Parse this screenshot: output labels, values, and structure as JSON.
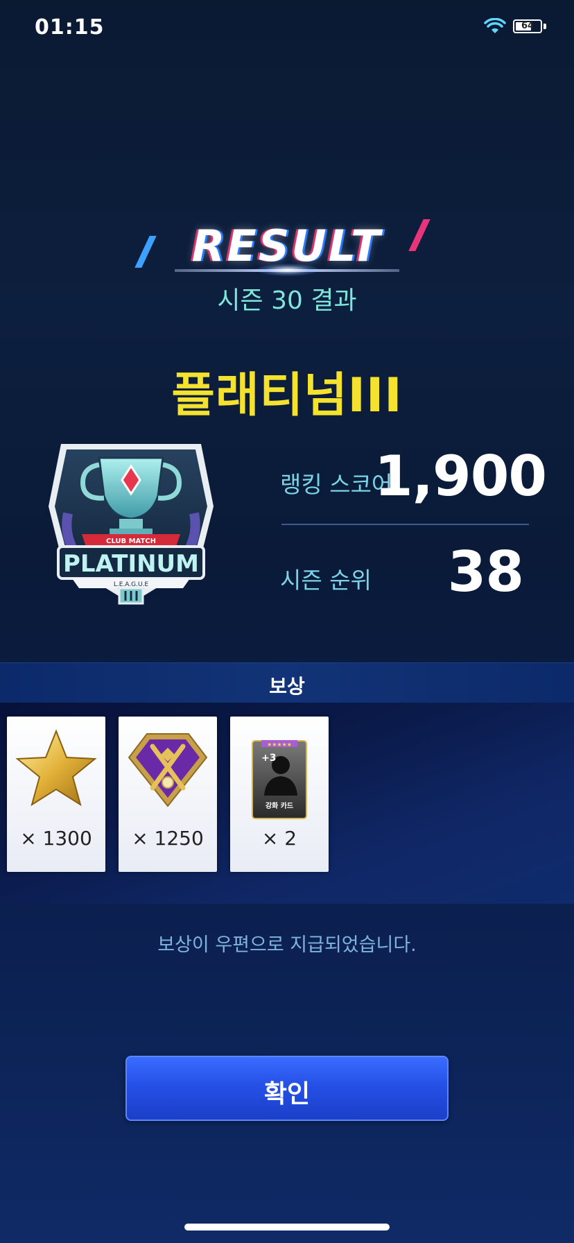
{
  "status_bar": {
    "time": "01:15",
    "battery_percent": "64",
    "battery_level": 0.64
  },
  "header": {
    "title": "RESULT",
    "subtitle": "시즌 30 결과"
  },
  "tier": {
    "name": "플래티넘III",
    "badge_texts": {
      "top": "CLUB MATCH",
      "main": "PLATINUM",
      "sub": "L.E.A.G.U.E"
    }
  },
  "stats": {
    "ranking_score_label": "랭킹 스코어",
    "ranking_score_value": "1,900",
    "season_rank_label": "시즌 순위",
    "season_rank_value": "38"
  },
  "rewards": {
    "title": "보상",
    "items": [
      {
        "icon": "gold-star-icon",
        "count": "× 1300"
      },
      {
        "icon": "purple-diamond-emblem-icon",
        "count": "× 1250"
      },
      {
        "icon": "enhance-card-icon",
        "count": "× 2",
        "card_label": "강화 카드",
        "card_bonus": "+3",
        "card_stars": "★★★★★"
      }
    ],
    "notice": "보상이 우편으로 지급되었습니다."
  },
  "confirm_button": {
    "label": "확인"
  },
  "colors": {
    "accent_cyan": "#7fe6dc",
    "tier_yellow": "#f5e22e",
    "button_blue": "#2550e6"
  }
}
